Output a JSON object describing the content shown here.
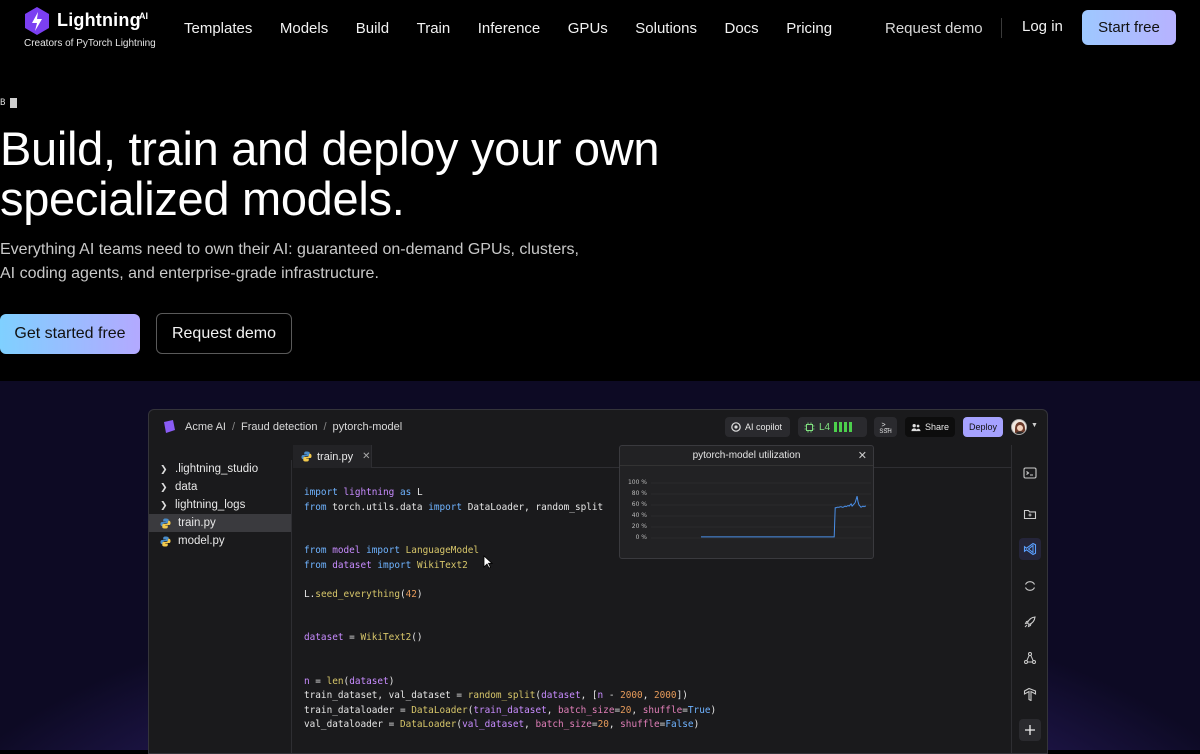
{
  "nav": {
    "logo": {
      "word": "Lightning",
      "ai": "AI",
      "tagline": "Creators of PyTorch Lightning"
    },
    "links": [
      "Templates",
      "Models",
      "Build",
      "Train",
      "Inference",
      "GPUs",
      "Solutions",
      "Docs",
      "Pricing"
    ],
    "request_demo": "Request demo",
    "login": "Log in",
    "start_free": "Start free"
  },
  "hero": {
    "typed": "B",
    "title_line1": "Build, train and deploy your own",
    "title_line2": "specialized models.",
    "subtitle_line1": "Everything AI teams need to own their AI: guaranteed on-demand GPUs, clusters,",
    "subtitle_line2": "AI coding agents, and enterprise-grade infrastructure.",
    "cta_primary": "Get started free",
    "cta_secondary": "Request demo"
  },
  "ide": {
    "breadcrumb": [
      "Acme AI",
      "Fraud detection",
      "pytorch-model"
    ],
    "copilot": "AI copilot",
    "gpu": "L4",
    "ssh": "SSH",
    "share": "Share",
    "deploy": "Deploy",
    "files": [
      {
        "name": ".lightning_studio",
        "type": "folder"
      },
      {
        "name": "data",
        "type": "folder"
      },
      {
        "name": "lightning_logs",
        "type": "folder"
      },
      {
        "name": "train.py",
        "type": "python",
        "active": true
      },
      {
        "name": "model.py",
        "type": "python"
      }
    ],
    "tab": "train.py",
    "utilization": {
      "title": "pytorch-model utilization",
      "y_ticks": [
        "100 %",
        "80 %",
        "60 %",
        "40 %",
        "20 %",
        "0 %"
      ]
    }
  },
  "chart_data": {
    "type": "line",
    "title": "pytorch-model utilization",
    "ylim": [
      0,
      100
    ],
    "y_ticks": [
      0,
      20,
      40,
      60,
      80,
      100
    ],
    "series": [
      {
        "values": [
          2,
          2,
          2,
          2,
          2,
          2,
          2,
          2,
          2,
          2,
          2,
          2,
          2,
          2,
          2,
          2,
          2,
          2,
          2,
          2,
          2,
          2,
          2,
          2,
          2,
          2,
          2,
          2,
          2,
          2,
          2,
          2,
          2,
          2,
          2,
          2,
          2,
          2,
          2,
          2,
          2,
          2,
          2,
          2,
          2,
          2,
          2,
          2,
          2,
          2,
          2,
          2,
          2,
          2,
          2,
          2,
          2,
          2,
          2,
          2,
          2,
          2,
          2,
          2,
          2,
          2,
          2,
          2,
          2,
          2,
          2,
          2,
          2,
          2,
          2,
          2,
          2,
          2,
          2,
          2,
          2,
          2,
          2,
          2,
          2,
          2,
          2,
          2,
          2,
          2,
          2,
          2,
          2,
          2,
          2,
          2,
          2,
          2,
          2,
          2,
          2,
          2,
          2,
          2,
          2,
          2,
          2,
          2,
          2,
          2,
          2,
          2,
          2,
          2,
          2,
          2,
          2,
          2,
          2,
          2,
          2,
          2,
          2,
          2,
          2,
          2,
          2,
          2,
          2,
          2,
          2,
          2,
          2,
          2,
          2,
          55,
          55,
          56,
          56,
          56,
          57,
          57,
          56,
          56,
          57,
          58,
          57,
          58,
          59,
          58,
          60,
          62,
          58,
          60,
          62,
          64,
          70,
          76,
          66,
          60,
          58,
          56,
          57,
          58,
          57,
          58,
          58
        ]
      }
    ]
  }
}
